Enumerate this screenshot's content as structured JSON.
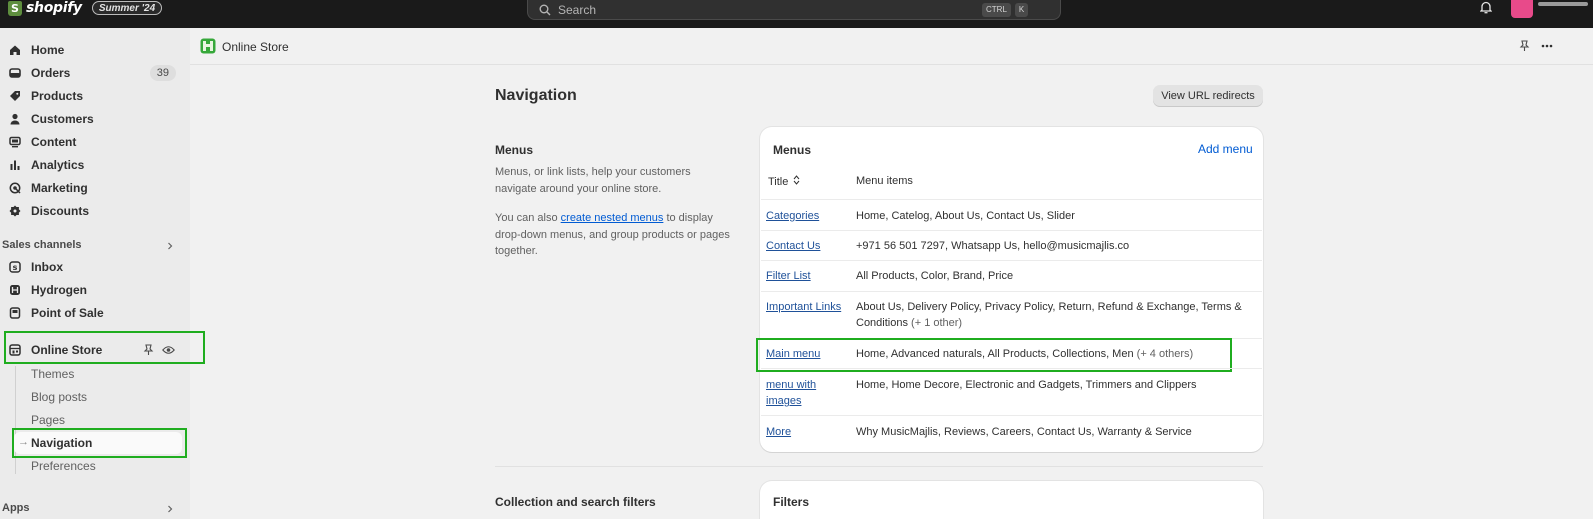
{
  "topbar": {
    "brand": "shopify",
    "brand_glyph": "S",
    "edition_badge": "Summer '24",
    "search_placeholder": "Search",
    "shortcut_keys": [
      "CTRL",
      "K"
    ]
  },
  "sidebar": {
    "main_items": [
      {
        "label": "Home",
        "icon": "home-icon"
      },
      {
        "label": "Orders",
        "icon": "orders-icon",
        "count": "39"
      },
      {
        "label": "Products",
        "icon": "tag-icon"
      },
      {
        "label": "Customers",
        "icon": "person-icon"
      },
      {
        "label": "Content",
        "icon": "content-icon"
      },
      {
        "label": "Analytics",
        "icon": "bar-chart-icon"
      },
      {
        "label": "Marketing",
        "icon": "target-icon"
      },
      {
        "label": "Discounts",
        "icon": "discount-icon"
      }
    ],
    "sales_channels_label": "Sales channels",
    "channel_items": [
      {
        "label": "Inbox",
        "icon": "inbox-icon"
      },
      {
        "label": "Hydrogen",
        "icon": "hydrogen-icon"
      },
      {
        "label": "Point of Sale",
        "icon": "pos-icon"
      }
    ],
    "online_store": {
      "label": "Online Store",
      "sub_items": [
        "Themes",
        "Blog posts",
        "Pages",
        "Navigation",
        "Preferences"
      ],
      "active": "Navigation"
    },
    "apps_label": "Apps"
  },
  "header": {
    "breadcrumb": "Online Store"
  },
  "page": {
    "title": "Navigation",
    "redirects_button": "View URL redirects",
    "menus_section": {
      "title": "Menus",
      "desc1": "Menus, or link lists, help your customers navigate around your online store.",
      "desc2_prefix": "You can also ",
      "desc2_link": "create nested menus",
      "desc2_suffix": " to display drop-down menus, and group products or pages together."
    },
    "filters_section": {
      "title": "Collection and search filters"
    }
  },
  "menus_card": {
    "title": "Menus",
    "add_menu": "Add menu",
    "col_title": "Title",
    "col_items": "Menu items",
    "rows": [
      {
        "title": "Categories",
        "items": "Home, Catelog, About Us, Contact Us, Slider",
        "more": ""
      },
      {
        "title": "Contact Us",
        "items": "+971 56 501 7297, Whatsapp Us, hello@musicmajlis.co",
        "more": ""
      },
      {
        "title": "Filter List",
        "items": "All Products, Color, Brand, Price",
        "more": ""
      },
      {
        "title": "Important Links",
        "items": "About Us, Delivery Policy, Privacy Policy, Return, Refund & Exchange, Terms & Conditions",
        "more": "(+ 1 other)"
      },
      {
        "title": "Main menu",
        "items": "Home, Advanced naturals, All Products, Collections, Men",
        "more": "(+ 4 others)"
      },
      {
        "title": "menu with images",
        "items": "Home, Home Decore, Electronic and Gadgets, Trimmers and Clippers",
        "more": ""
      },
      {
        "title": "More",
        "items": "Why MusicMajlis, Reviews, Careers, Contact Us, Warranty & Service",
        "more": ""
      }
    ]
  },
  "filters_card": {
    "title": "Filters"
  },
  "colors": {
    "topbar": "#1a1a1a",
    "highlight": "#1fad1f",
    "link": "#005bd3"
  }
}
